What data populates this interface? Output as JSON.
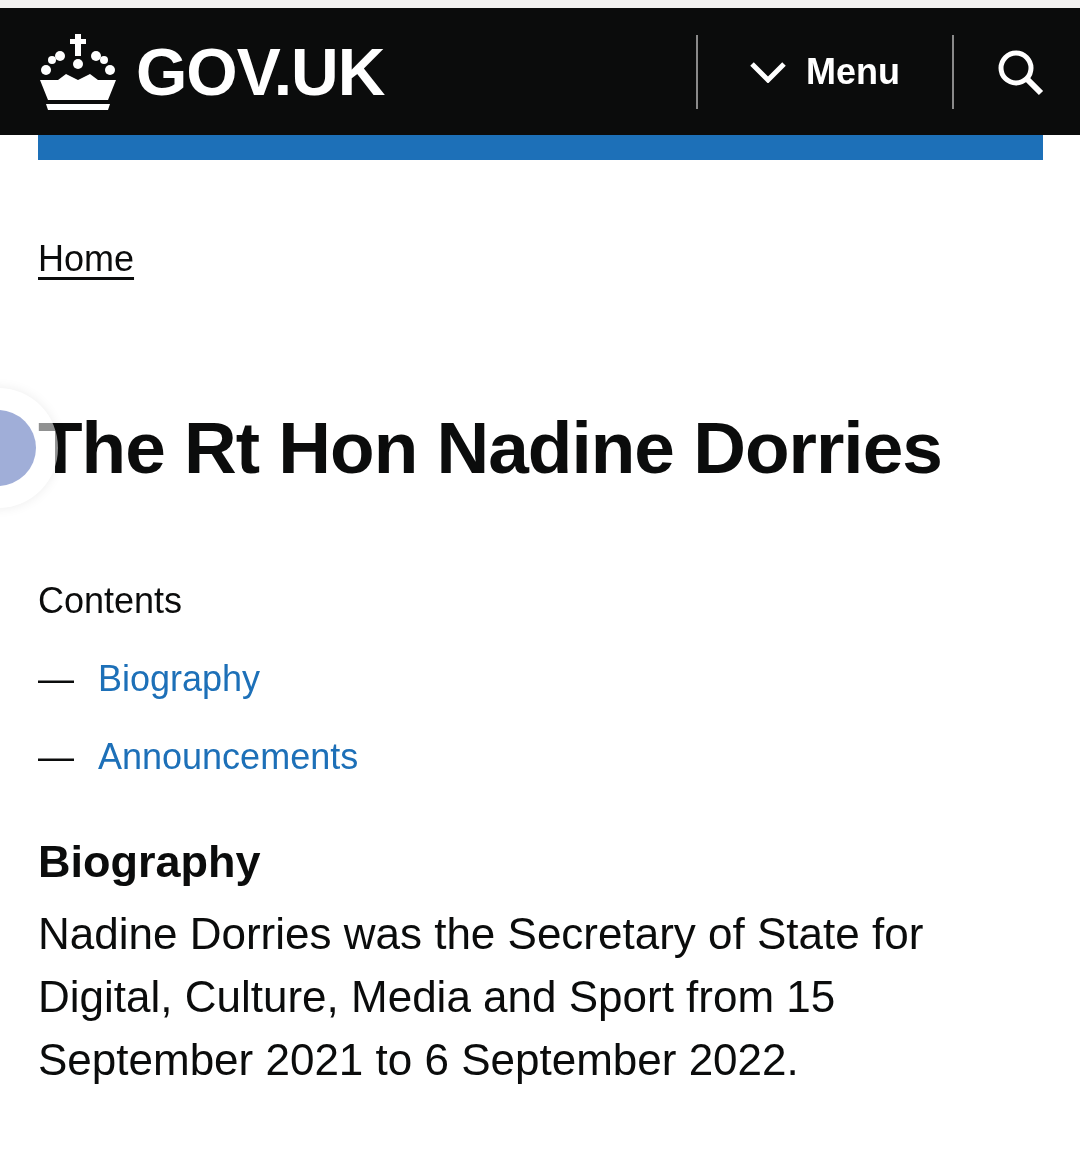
{
  "header": {
    "logo": "GOV.UK",
    "menu_button": "Menu"
  },
  "breadcrumbs": [
    "Home"
  ],
  "title": "The Rt Hon Nadine Dorries",
  "contents": {
    "heading": "Contents",
    "items": [
      {
        "dash": "—",
        "label": "Biography"
      },
      {
        "dash": "—",
        "label": "Announcements"
      }
    ]
  },
  "biography": {
    "heading": "Biography",
    "text": "Nadine Dorries was the Secretary of State for Digital, Culture, Media and Sport from 15 September 2021 to 6 September 2022."
  }
}
